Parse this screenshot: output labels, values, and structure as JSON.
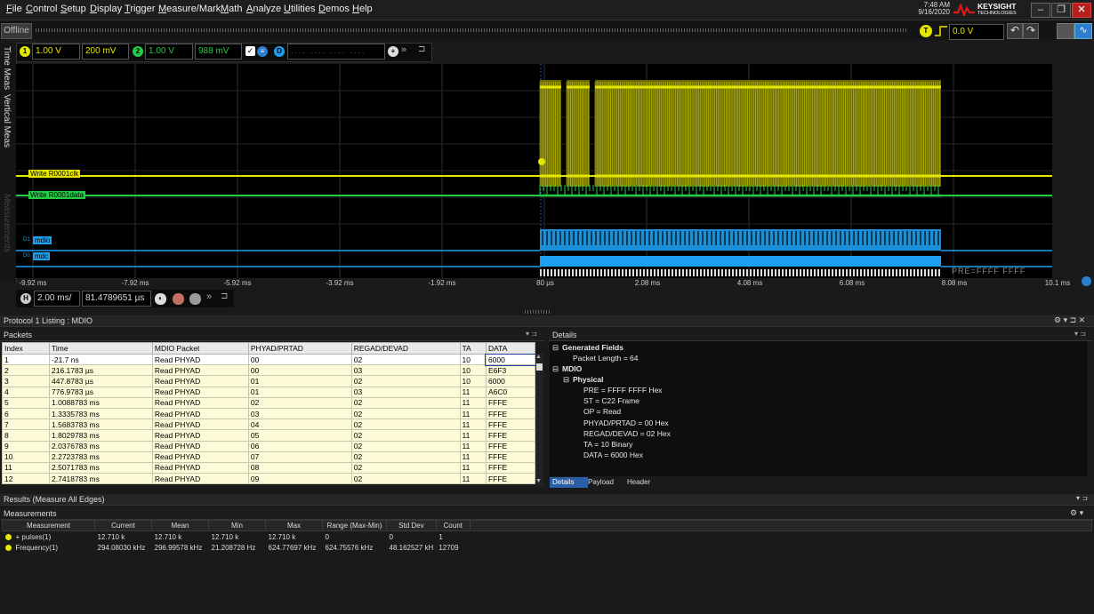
{
  "menu": [
    "File",
    "Control",
    "Setup",
    "Display",
    "Trigger",
    "Measure/Mark",
    "Math",
    "Analyze",
    "Utilities",
    "Demos",
    "Help"
  ],
  "clock": {
    "time": "7:48 AM",
    "date": "9/16/2020"
  },
  "brand": {
    "name": "KEYSIGHT",
    "sub": "TECHNOLOGIES"
  },
  "window_buttons": [
    "minimize",
    "restore",
    "close"
  ],
  "status": {
    "mode": "Offline"
  },
  "trigger": {
    "label": "T",
    "level": "0.0 V"
  },
  "channels": [
    {
      "id": "1",
      "scale": "1.00 V",
      "offset": "200 mV",
      "color": "#e6e600"
    },
    {
      "id": "2",
      "scale": "1.00 V",
      "offset": "988 mV",
      "color": "#22cc44"
    }
  ],
  "digital": {
    "label": "D",
    "pattern": ". . . .   . . . .   . . . .   . . . ."
  },
  "side_tabs": [
    "Time Meas",
    "Vertical Meas",
    "Measurements"
  ],
  "scope": {
    "traces": [
      {
        "label": "Write R0001clk",
        "color": "#e6e600"
      },
      {
        "label": "Write R0001data",
        "color": "#22cc44"
      },
      {
        "label": "mdio",
        "prefix": "D1",
        "color": "#1ea0f0"
      },
      {
        "label": "mdc",
        "prefix": "D0",
        "color": "#1ea0f0"
      }
    ],
    "decode_text": "PRE=FFFF FFFF",
    "x_ticks": [
      "-9.92 ms",
      "-7.92 ms",
      "-5.92 ms",
      "-3.92 ms",
      "-1.92 ms",
      "80 µs",
      "2.08 ms",
      "4.08 ms",
      "6.08 ms",
      "8.08 ms",
      "10.1 ms"
    ]
  },
  "horizontal": {
    "label": "H",
    "scale": "2.00 ms/",
    "position": "81.4789651 µs"
  },
  "listing": {
    "title": "Protocol 1 Listing : MDIO",
    "packets_title": "Packets",
    "columns": [
      "Index",
      "Time",
      "MDIO Packet",
      "PHYAD/PRTAD",
      "REGAD/DEVAD",
      "TA",
      "DATA"
    ],
    "rows": [
      [
        "1",
        "-21.7 ns",
        "Read PHYAD",
        "00",
        "02",
        "10",
        "6000"
      ],
      [
        "2",
        "216.1783 µs",
        "Read PHYAD",
        "00",
        "03",
        "10",
        "E6F3"
      ],
      [
        "3",
        "447.8783 µs",
        "Read PHYAD",
        "01",
        "02",
        "10",
        "6000"
      ],
      [
        "4",
        "776.9783 µs",
        "Read PHYAD",
        "01",
        "03",
        "11",
        "A6C0"
      ],
      [
        "5",
        "1.0088783 ms",
        "Read PHYAD",
        "02",
        "02",
        "11",
        "FFFE"
      ],
      [
        "6",
        "1.3335783 ms",
        "Read PHYAD",
        "03",
        "02",
        "11",
        "FFFE"
      ],
      [
        "7",
        "1.5683783 ms",
        "Read PHYAD",
        "04",
        "02",
        "11",
        "FFFE"
      ],
      [
        "8",
        "1.8029783 ms",
        "Read PHYAD",
        "05",
        "02",
        "11",
        "FFFE"
      ],
      [
        "9",
        "2.0376783 ms",
        "Read PHYAD",
        "06",
        "02",
        "11",
        "FFFE"
      ],
      [
        "10",
        "2.2723783 ms",
        "Read PHYAD",
        "07",
        "02",
        "11",
        "FFFE"
      ],
      [
        "11",
        "2.5071783 ms",
        "Read PHYAD",
        "08",
        "02",
        "11",
        "FFFE"
      ],
      [
        "12",
        "2.7418783 ms",
        "Read PHYAD",
        "09",
        "02",
        "11",
        "FFFE"
      ]
    ],
    "details_title": "Details",
    "details": {
      "generated": "Generated Fields",
      "packet_length": "Packet Length = 64",
      "mdio": "MDIO",
      "physical": "Physical",
      "fields": [
        "PRE = FFFF FFFF Hex",
        "ST = C22 Frame",
        "OP = Read",
        "PHYAD/PRTAD = 00 Hex",
        "REGAD/DEVAD = 02 Hex",
        "TA = 10 Binary",
        "DATA = 6000 Hex"
      ]
    },
    "detail_tabs": [
      "Details",
      "Payload",
      "Header"
    ]
  },
  "results": {
    "title": "Results  (Measure All Edges)",
    "meas_title": "Measurements",
    "columns": [
      "Measurement",
      "Current",
      "Mean",
      "Min",
      "Max",
      "Range (Max-Min)",
      "Std Dev",
      "Count"
    ],
    "rows": [
      [
        "+ pulses(1)",
        "12.710 k",
        "12.710 k",
        "12.710 k",
        "12.710 k",
        "0",
        "0",
        "1"
      ],
      [
        "Frequency(1)",
        "294.08030 kHz",
        "296.99578 kHz",
        "21.208728 Hz",
        "624.77697 kHz",
        "624.75576 kHz",
        "48.162527 kH",
        "12709"
      ]
    ]
  },
  "colors": {
    "yellow": "#e6e600",
    "green": "#22cc44",
    "blue": "#1ea0f0",
    "highlight": "#fdfbd7"
  }
}
